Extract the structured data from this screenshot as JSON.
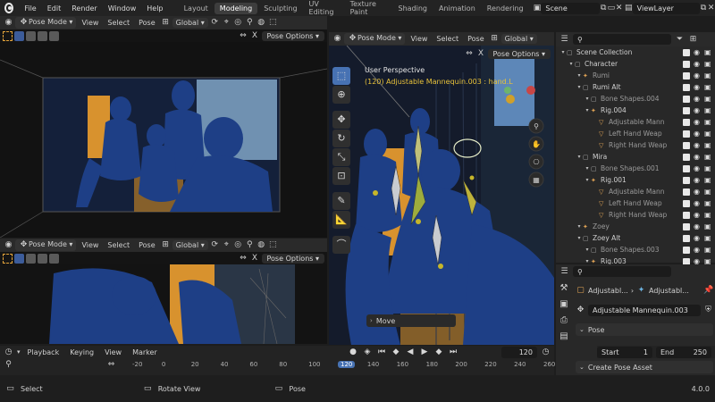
{
  "topbar": {
    "menus": [
      "File",
      "Edit",
      "Render",
      "Window",
      "Help"
    ],
    "workspaces": [
      "Layout",
      "Modeling",
      "Sculpting",
      "UV Editing",
      "Texture Paint",
      "Shading",
      "Animation",
      "Rendering"
    ],
    "active_workspace": "Modeling",
    "scene": "Scene",
    "view_layer": "ViewLayer"
  },
  "viewport_header": {
    "mode": "Pose Mode",
    "view": "View",
    "select": "Select",
    "pose": "Pose",
    "orientation": "Global",
    "pose_options": "Pose Options",
    "axis_x": "X"
  },
  "main_viewport": {
    "view_name": "User Perspective",
    "object_info": "(120) Adjustable Mannequin.003 : hand.L",
    "operator_panel": "Move"
  },
  "outliner": {
    "rows": [
      {
        "label": "Scene Collection",
        "indent": 0,
        "icon": "collection"
      },
      {
        "label": "Character",
        "indent": 1,
        "icon": "collection"
      },
      {
        "label": "Rumi",
        "indent": 2,
        "icon": "armature",
        "dim": true
      },
      {
        "label": "Rumi Alt",
        "indent": 2,
        "icon": "collection"
      },
      {
        "label": "Bone Shapes.004",
        "indent": 3,
        "icon": "collection",
        "dim": true
      },
      {
        "label": "Rig.004",
        "indent": 3,
        "icon": "armature"
      },
      {
        "label": "Adjustable Mann",
        "indent": 4,
        "icon": "mesh",
        "dim": true
      },
      {
        "label": "Left Hand Weap",
        "indent": 4,
        "icon": "mesh",
        "dim": true
      },
      {
        "label": "Right Hand Weap",
        "indent": 4,
        "icon": "mesh",
        "dim": true
      },
      {
        "label": "Mira",
        "indent": 2,
        "icon": "collection"
      },
      {
        "label": "Bone Shapes.001",
        "indent": 3,
        "icon": "collection",
        "dim": true
      },
      {
        "label": "Rig.001",
        "indent": 3,
        "icon": "armature"
      },
      {
        "label": "Adjustable Mann",
        "indent": 4,
        "icon": "mesh",
        "dim": true
      },
      {
        "label": "Left Hand Weap",
        "indent": 4,
        "icon": "mesh",
        "dim": true
      },
      {
        "label": "Right Hand Weap",
        "indent": 4,
        "icon": "mesh",
        "dim": true
      },
      {
        "label": "Zoey",
        "indent": 2,
        "icon": "armature",
        "dim": true
      },
      {
        "label": "Zoey Alt",
        "indent": 2,
        "icon": "collection"
      },
      {
        "label": "Bone Shapes.003",
        "indent": 3,
        "icon": "collection",
        "dim": true
      },
      {
        "label": "Rig.003",
        "indent": 3,
        "icon": "armature"
      }
    ]
  },
  "properties": {
    "breadcrumb_1": "Adjustabl...",
    "breadcrumb_2": "Adjustabl...",
    "object_name": "Adjustable Mannequin.003",
    "section": "Pose",
    "create_pose_asset": "Create Pose Asset"
  },
  "timeline": {
    "menus": [
      "Playback",
      "Keying",
      "View",
      "Marker"
    ],
    "current_frame": "120",
    "start_label": "Start",
    "start": "1",
    "end_label": "End",
    "end": "250",
    "ticks": [
      "-20",
      "0",
      "20",
      "40",
      "60",
      "80",
      "100",
      "120",
      "140",
      "160",
      "180",
      "200",
      "220",
      "240",
      "260"
    ],
    "ruler_range": [
      -20,
      260
    ]
  },
  "statusbar": {
    "select": "Select",
    "rotate": "Rotate View",
    "pose": "Pose",
    "version": "4.0.0"
  },
  "colors": {
    "accent": "#4772b3",
    "mannequin": "#1e3f86",
    "wall_orange": "#d8922e",
    "frame_marker": "#4772b3"
  }
}
